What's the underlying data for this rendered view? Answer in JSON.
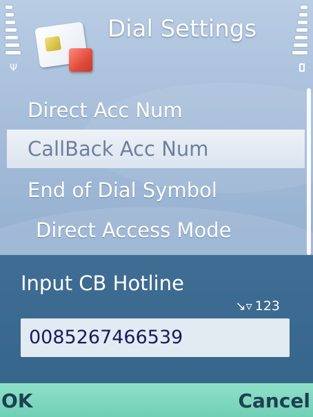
{
  "header": {
    "title": "Dial Settings",
    "app_icon": "sim-card-icon"
  },
  "status": {
    "signal_icon": "signal-strength-icon",
    "battery_icon": "battery-level-icon"
  },
  "list": {
    "items": [
      {
        "label": "Direct Acc Num"
      },
      {
        "label": "CallBack Acc Num",
        "selected": true
      },
      {
        "label": "End of Dial Symbol"
      },
      {
        "label": "Direct Access Mode"
      }
    ]
  },
  "dialog": {
    "title": "Input CB Hotline",
    "input_mode": "123",
    "input_mode_icon": "pen-icon",
    "value": "0085267466539"
  },
  "softkeys": {
    "left": "OK",
    "right": "Cancel"
  },
  "colors": {
    "background": "#a6bdd9",
    "selected_row": "#dbe4ef",
    "dialog": "#3f6d93",
    "softkey_bar": "#7fd8bf"
  }
}
